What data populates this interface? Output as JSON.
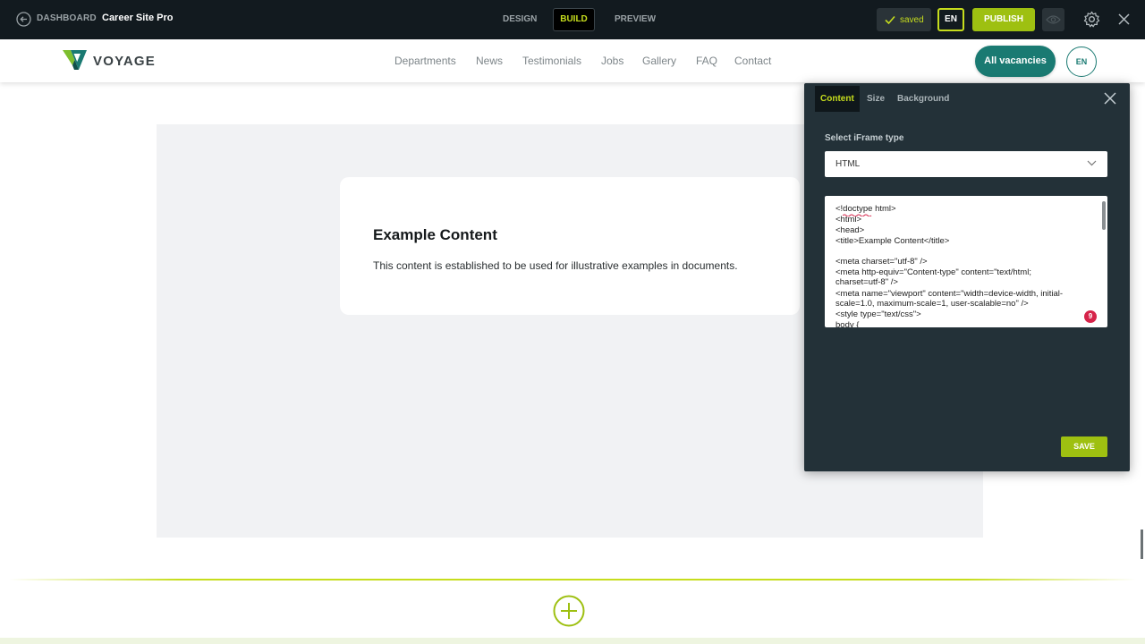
{
  "topbar": {
    "dashboard_label": "DASHBOARD",
    "site_name": "Career Site Pro",
    "modes": [
      "DESIGN",
      "BUILD",
      "PREVIEW"
    ],
    "saved_label": "saved",
    "lang": "EN",
    "publish_label": "PUBLISH"
  },
  "site": {
    "logo_text": "VOYAGE",
    "nav": [
      "Departments",
      "News",
      "Testimonials",
      "Jobs",
      "Gallery",
      "FAQ",
      "Contact"
    ],
    "cta_label": "All vacancies",
    "lang": "EN"
  },
  "content": {
    "title": "Example Content",
    "text": "This content is established to be used for illustrative examples in documents."
  },
  "panel": {
    "tabs": [
      "Content",
      "Size",
      "Background"
    ],
    "select_label": "Select iFrame type",
    "select_value": "HTML",
    "code_lines": [
      "<!doctype html>",
      "<html>",
      "<head>",
      "    <title>Example Content</title>",
      "",
      "    <meta charset=\"utf-8\" />",
      "    <meta http-equiv=\"Content-type\" content=\"text/html;",
      "charset=utf-8\" />",
      "    <meta name=\"viewport\" content=\"width=device-width, initial-",
      "scale=1.0, maximum-scale=1, user-scalable=no\" />",
      "    <style type=\"text/css\">",
      "    body {"
    ],
    "error_count": "9",
    "save_label": "SAVE"
  },
  "colors": {
    "accent": "#c6dd1d",
    "publish": "#9ec011",
    "brand_teal": "#1a7a72",
    "topbar_bg": "#121a1f",
    "panel_bg": "#233138"
  }
}
